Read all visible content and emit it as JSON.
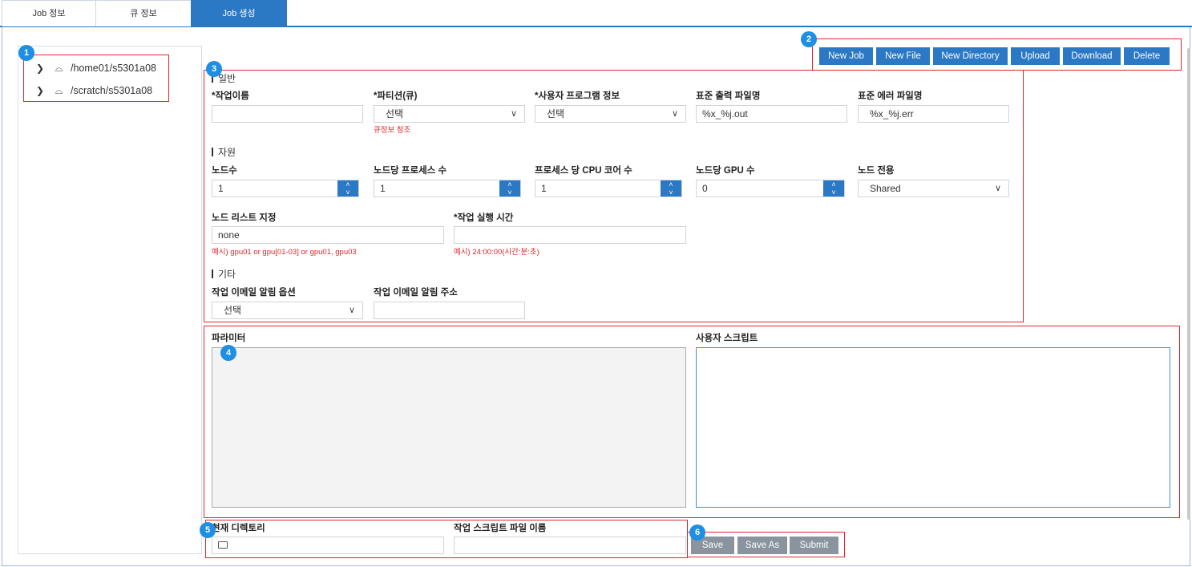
{
  "tabs": [
    "Job 정보",
    "큐 정보",
    "Job 생성"
  ],
  "tree": [
    "/home01/s5301a08",
    "/scratch/s5301a08"
  ],
  "badges": [
    "1",
    "2",
    "3",
    "4",
    "5",
    "6"
  ],
  "toolbar": [
    "New Job",
    "New File",
    "New Directory",
    "Upload",
    "Download",
    "Delete"
  ],
  "general": {
    "title": "일반",
    "job_name_label": "*작업이름",
    "job_name_value": "",
    "partition_label": "*파티션(큐)",
    "partition_value": "선택",
    "partition_hint": "큐정보 참조",
    "program_label": "*사용자 프로그램 정보",
    "program_value": "선택",
    "stdout_label": "표준 출력 파일명",
    "stdout_value": "%x_%j.out",
    "stderr_label": "표준 에러 파일명",
    "stderr_value": "%x_%j.err"
  },
  "resources": {
    "title": "자원",
    "nodes_label": "노드수",
    "nodes_value": "1",
    "procs_label": "노드당 프로세스 수",
    "procs_value": "1",
    "cores_label": "프로세스 당 CPU 코어 수",
    "cores_value": "1",
    "gpus_label": "노드당 GPU 수",
    "gpus_value": "0",
    "exclusive_label": "노드 전용",
    "exclusive_value": "Shared",
    "nodelist_label": "노드 리스트 지정",
    "nodelist_value": "none",
    "nodelist_hint": "예시) gpu01 or gpu[01-03] or gpu01, gpu03",
    "runtime_label": "*작업 실행 시간",
    "runtime_value": "",
    "runtime_hint": "예시) 24:00:00(시간:분:초)"
  },
  "other": {
    "title": "기타",
    "email_option_label": "작업 이메일 알림 옵션",
    "email_option_value": "선택",
    "email_address_label": "작업 이메일 알림 주소",
    "email_address_value": ""
  },
  "parameters_label": "파라미터",
  "script_label": "사용자 스크립트",
  "current_dir_label": "현재 디렉토리",
  "script_file_label": "작업 스크립트 파일 이름",
  "actions": [
    "Save",
    "Save As",
    "Submit"
  ],
  "colors": {
    "accent": "#2b78c5",
    "highlight": "#e0262b",
    "badge": "#1e8fe3",
    "gray_button": "#8a949e"
  }
}
